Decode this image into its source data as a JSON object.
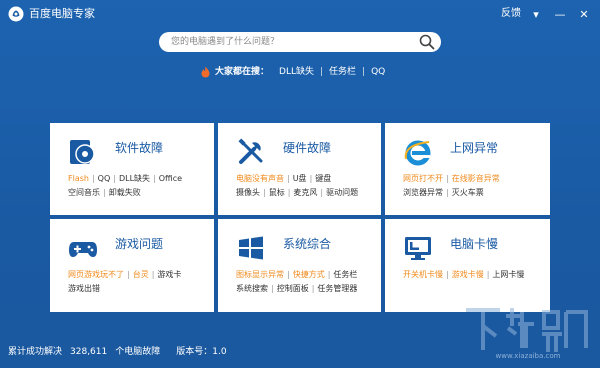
{
  "app": {
    "title": "百度电脑专家"
  },
  "titlebar": {
    "feedback": "反馈",
    "menu_glyph": "▾",
    "minimize_glyph": "—",
    "close_glyph": "✕"
  },
  "search": {
    "placeholder": "您的电脑遇到了什么问题？"
  },
  "hot": {
    "label": "大家都在搜：",
    "items": [
      "DLL缺失",
      "任务栏",
      "QQ"
    ]
  },
  "cards": [
    {
      "title": "软件故障",
      "icon": "software-disc-icon",
      "row1": [
        {
          "t": "Flash",
          "c": "o"
        },
        {
          "t": "QQ",
          "c": "k"
        },
        {
          "t": "DLL缺失",
          "c": "k"
        },
        {
          "t": "Office",
          "c": "k"
        }
      ],
      "row2": [
        {
          "t": "空间音乐",
          "c": "k"
        },
        {
          "t": "卸载失败",
          "c": "k"
        }
      ]
    },
    {
      "title": "硬件故障",
      "icon": "hardware-tools-icon",
      "row1": [
        {
          "t": "电脑没有声音",
          "c": "o"
        },
        {
          "t": "U盘",
          "c": "k"
        },
        {
          "t": "键盘",
          "c": "k"
        }
      ],
      "row2": [
        {
          "t": "摄像头",
          "c": "k"
        },
        {
          "t": "鼠标",
          "c": "k"
        },
        {
          "t": "麦克风",
          "c": "k"
        },
        {
          "t": "驱动问题",
          "c": "k"
        }
      ]
    },
    {
      "title": "上网异常",
      "icon": "internet-explorer-icon",
      "row1": [
        {
          "t": "网页打不开",
          "c": "o"
        },
        {
          "t": "在线影音异常",
          "c": "o"
        }
      ],
      "row2": [
        {
          "t": "浏览器异常",
          "c": "k"
        },
        {
          "t": "灭火车票",
          "c": "k"
        }
      ]
    },
    {
      "title": "游戏问题",
      "icon": "gamepad-icon",
      "row1": [
        {
          "t": "网页游戏玩不了",
          "c": "o"
        },
        {
          "t": "台灵",
          "c": "o"
        },
        {
          "t": "游戏卡",
          "c": "k"
        }
      ],
      "row2": [
        {
          "t": "游戏出错",
          "c": "k"
        }
      ]
    },
    {
      "title": "系统综合",
      "icon": "windows-logo-icon",
      "row1": [
        {
          "t": "图标显示异常",
          "c": "o"
        },
        {
          "t": "快捷方式",
          "c": "o"
        },
        {
          "t": "任务栏",
          "c": "k"
        }
      ],
      "row2": [
        {
          "t": "系统搜索",
          "c": "k"
        },
        {
          "t": "控制面板",
          "c": "k"
        },
        {
          "t": "任务管理器",
          "c": "k"
        }
      ]
    },
    {
      "title": "电脑卡慢",
      "icon": "monitor-slow-icon",
      "row1": [
        {
          "t": "开关机卡慢",
          "c": "o"
        },
        {
          "t": "游戏卡慢",
          "c": "o"
        },
        {
          "t": "上网卡慢",
          "c": "k"
        }
      ],
      "row2": []
    }
  ],
  "status": {
    "solved_label": "累计成功解决",
    "solved_count": "328,611",
    "solved_unit": "个电脑故障",
    "version_label": "版本号：1.0"
  },
  "watermark": {
    "text": "下载吧",
    "url": "www.xiazaiba.com"
  },
  "colors": {
    "background": "#1a5aa3",
    "accent": "#1a5aa3",
    "link_highlight": "#f08a1c",
    "card": "#ffffff"
  }
}
